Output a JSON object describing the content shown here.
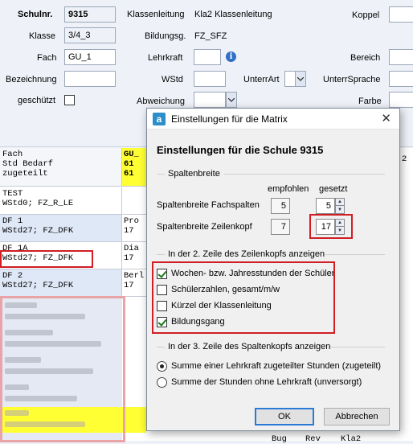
{
  "form": {
    "schulnr_label": "Schulnr.",
    "schulnr_value": "9315",
    "klassenleitung_label": "Klassenleitung",
    "klassenleitung_value": "Kla2 Klassenleitung",
    "koppel_label": "Koppel",
    "klasse_label": "Klasse",
    "klasse_value": "3/4_3",
    "bildungsg_label": "Bildungsg.",
    "bildungsg_value": "FZ_SFZ",
    "fach_label": "Fach",
    "fach_value": "GU_1",
    "lehrkraft_label": "Lehrkraft",
    "bereich_label": "Bereich",
    "bezeichnung_label": "Bezeichnung",
    "wstd_label": "WStd",
    "unterrart_label": "UnterrArt",
    "unterrsprache_label": "UnterrSprache",
    "geschuetzt_label": "geschützt",
    "abweichung_label": "Abweichung",
    "farbe_label": "Farbe"
  },
  "matrix": {
    "header_lines": [
      "Fach",
      "Std Bedarf",
      "zugeteilt"
    ],
    "header_cell": [
      "GU_",
      "61",
      "61"
    ],
    "header_cell_right": "2",
    "rows": [
      {
        "l1": "TEST",
        "l2": "WStd0; FZ_R_LE",
        "c1": "",
        "c2": ""
      },
      {
        "l1": "DF 1",
        "l2": "WStd27; FZ_DFK",
        "c1": "Pro",
        "c2": "17"
      },
      {
        "l1": "DF 1A",
        "l2": "WStd27; FZ_DFK",
        "c1": "Dia",
        "c2": "17"
      },
      {
        "l1": "DF 2",
        "l2": "WStd27; FZ_DFK",
        "c1": "Berl",
        "c2": "17"
      }
    ],
    "bottom_cells": [
      "Bug",
      "Rev",
      "Kla2"
    ]
  },
  "dialog": {
    "window_title": "Einstellungen für die Matrix",
    "app_icon": "a",
    "heading": "Einstellungen für die Schule 9315",
    "section_spaltenbreite": "Spaltenbreite",
    "col_empfohlen": "empfohlen",
    "col_gesetzt": "gesetzt",
    "fachspalten_label": "Spaltenbreite Fachspalten",
    "fachspalten_empfohlen": "5",
    "fachspalten_gesetzt": "5",
    "zeilenkopf_label": "Spaltenbreite Zeilenkopf",
    "zeilenkopf_empfohlen": "7",
    "zeilenkopf_gesetzt": "17",
    "section_zeile2": "In der 2. Zeile des Zeilenkopfs anzeigen",
    "checkboxes": [
      {
        "label": "Wochen- bzw. Jahresstunden der Schüler",
        "checked": true
      },
      {
        "label": "Schülerzahlen, gesamt/m/w",
        "checked": false
      },
      {
        "label": "Kürzel der Klassenleitung",
        "checked": false
      },
      {
        "label": "Bildungsgang",
        "checked": true
      }
    ],
    "section_zeile3": "In der 3. Zeile des Spaltenkopfs anzeigen",
    "radios": [
      {
        "label": "Summe einer Lehrkraft zugeteilter Stunden (zugeteilt)",
        "selected": true
      },
      {
        "label": "Summe der Stunden ohne Lehrkraft (unversorgt)",
        "selected": false
      }
    ],
    "ok_label": "OK",
    "cancel_label": "Abbrechen"
  },
  "colors": {
    "highlight_red": "#d01e24",
    "header_yellow": "#ffff33",
    "row_blue": "#dfe8f6",
    "accent_blue": "#2d8ec9"
  }
}
